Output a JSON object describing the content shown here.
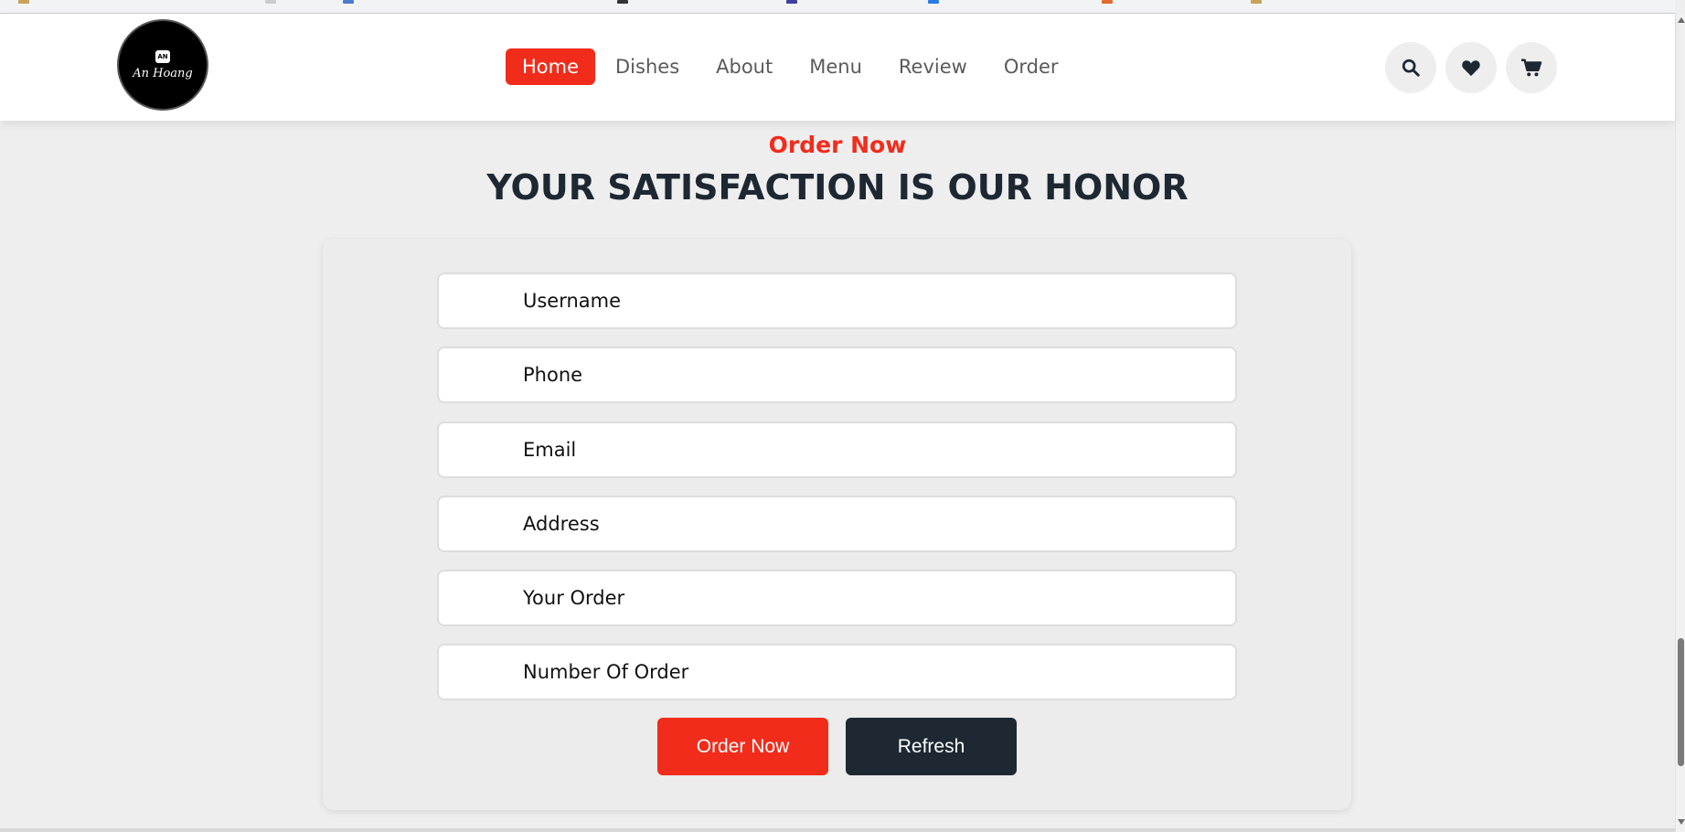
{
  "logo": {
    "badge": "AN",
    "text": "An Hoang"
  },
  "nav": {
    "items": [
      {
        "label": "Home",
        "active": true
      },
      {
        "label": "Dishes",
        "active": false
      },
      {
        "label": "About",
        "active": false
      },
      {
        "label": "Menu",
        "active": false
      },
      {
        "label": "Review",
        "active": false
      },
      {
        "label": "Order",
        "active": false
      }
    ]
  },
  "header_icons": [
    "search-icon",
    "heart-icon",
    "cart-icon"
  ],
  "section": {
    "eyebrow": "Order Now",
    "title": "YOUR SATISFACTION IS OUR HONOR"
  },
  "form": {
    "fields": [
      {
        "placeholder": "Username",
        "value": ""
      },
      {
        "placeholder": "Phone",
        "value": ""
      },
      {
        "placeholder": "Email",
        "value": ""
      },
      {
        "placeholder": "Address",
        "value": ""
      },
      {
        "placeholder": "Your Order",
        "value": ""
      },
      {
        "placeholder": "Number Of Order",
        "value": ""
      }
    ],
    "submit_label": "Order Now",
    "refresh_label": "Refresh"
  },
  "colors": {
    "accent": "#f22c1b",
    "dark": "#1e2833",
    "background": "#eeeeee"
  }
}
